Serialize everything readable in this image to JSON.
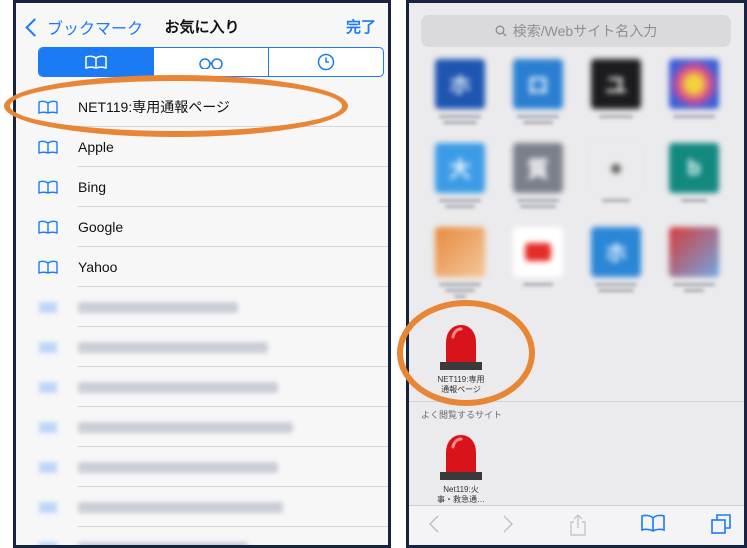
{
  "left": {
    "back_label": "ブックマーク",
    "title": "お気に入り",
    "done_label": "完了",
    "segments": [
      "bookmarks",
      "reading-list",
      "history"
    ],
    "items": [
      {
        "label": "NET119:専用通報ページ"
      },
      {
        "label": "Apple"
      },
      {
        "label": "Bing"
      },
      {
        "label": "Google"
      },
      {
        "label": "Yahoo"
      }
    ],
    "blurred_rows": 7
  },
  "right": {
    "search_placeholder": "検索/Webサイト名入力",
    "favorites_top_row": [
      "ホ",
      "ロ",
      "ユ",
      ""
    ],
    "favorites_row2": [
      "大",
      "質",
      "",
      ""
    ],
    "favorites_row3": [
      "",
      "",
      "ホ",
      ""
    ],
    "net119_caption_line1": "NET119:専用",
    "net119_caption_line2": "通報ページ",
    "frequent_section": "よく閲覧するサイト",
    "frequent_caption_line1": "Net119:火",
    "frequent_caption_line2": "事・救急通…"
  },
  "colors": {
    "ios_blue": "#1b7bf5",
    "annotation_orange": "#e98636",
    "frame_navy": "#17233f",
    "siren_red": "#d8141a"
  }
}
